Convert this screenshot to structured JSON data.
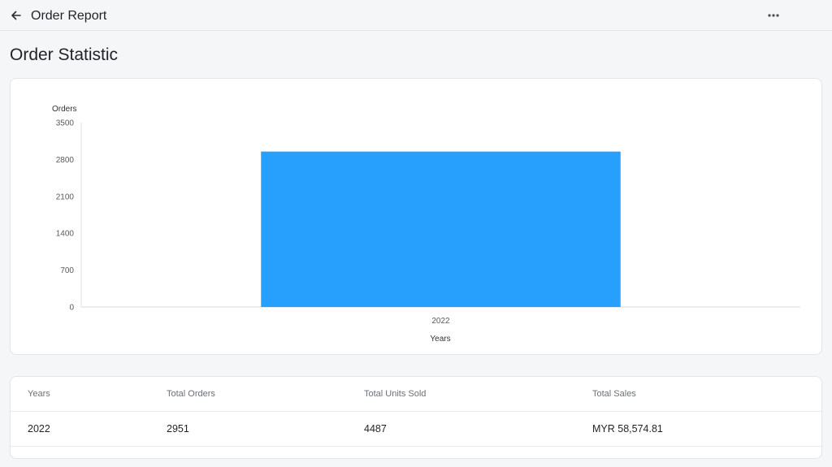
{
  "header": {
    "title": "Order Report",
    "back_icon": "arrow-left-icon",
    "more_icon": "more-horizontal-icon"
  },
  "page_title": "Order Statistic",
  "chart_data": {
    "type": "bar",
    "categories": [
      "2022"
    ],
    "values": [
      2951
    ],
    "ylabel": "Orders",
    "xlabel": "Years",
    "ylim": [
      0,
      3500
    ],
    "yticks": [
      0,
      700,
      1400,
      2100,
      2800,
      3500
    ],
    "bar_color": "#279ffd",
    "grid": false
  },
  "table": {
    "columns": [
      "Years",
      "Total Orders",
      "Total Units Sold",
      "Total Sales"
    ],
    "rows": [
      [
        "2022",
        "2951",
        "4487",
        "MYR 58,574.81"
      ]
    ]
  }
}
